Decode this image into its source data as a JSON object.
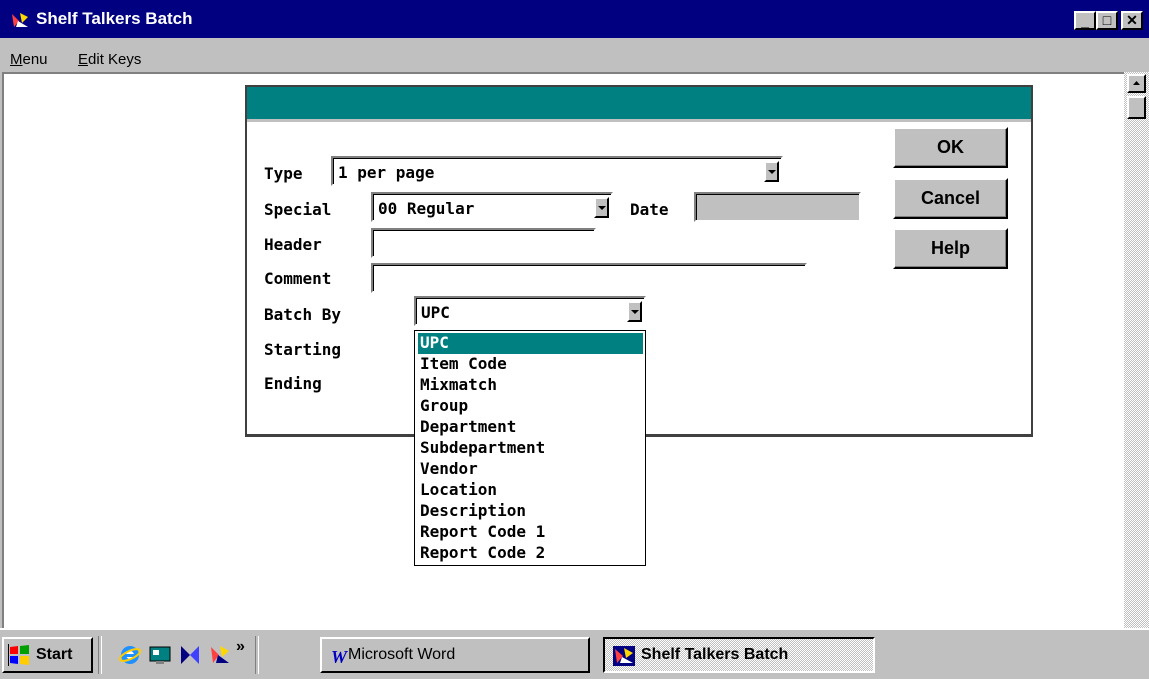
{
  "window": {
    "title": "Shelf Talkers Batch",
    "controls": {
      "minimize": "_",
      "maximize": "□",
      "close": "✕"
    }
  },
  "menubar": {
    "items": [
      "Menu",
      "Edit Keys"
    ]
  },
  "dialog": {
    "type": {
      "label": "Type",
      "value": "1 per page"
    },
    "special": {
      "label": "Special",
      "value": "00 Regular"
    },
    "date": {
      "label": "Date",
      "value": ""
    },
    "header": {
      "label": "Header",
      "value": ""
    },
    "comment": {
      "label": "Comment",
      "value": ""
    },
    "batch_by": {
      "label": "Batch By",
      "value": "UPC",
      "options": [
        "UPC",
        "Item Code",
        "Mixmatch",
        "Group",
        "Department",
        "Subdepartment",
        "Vendor",
        "Location",
        "Description",
        "Report Code 1",
        "Report Code 2"
      ],
      "selected_index": 0
    },
    "starting": {
      "label": "Starting"
    },
    "ending": {
      "label": "Ending"
    },
    "buttons": {
      "ok": "OK",
      "cancel": "Cancel",
      "help": "Help"
    }
  },
  "taskbar": {
    "start_label": "Start",
    "chevron": "»",
    "quick_launch": [
      "internet-explorer-icon",
      "show-desktop-icon",
      "tool-icon",
      "app-icon"
    ],
    "tasks": [
      {
        "label": "Microsoft Word",
        "icon": "word-icon",
        "active": false
      },
      {
        "label": "Shelf Talkers Batch",
        "icon": "app-icon",
        "active": true
      }
    ]
  },
  "colors": {
    "titlebar": "#000080",
    "dialog_title": "#008080",
    "selection": "#008080"
  }
}
